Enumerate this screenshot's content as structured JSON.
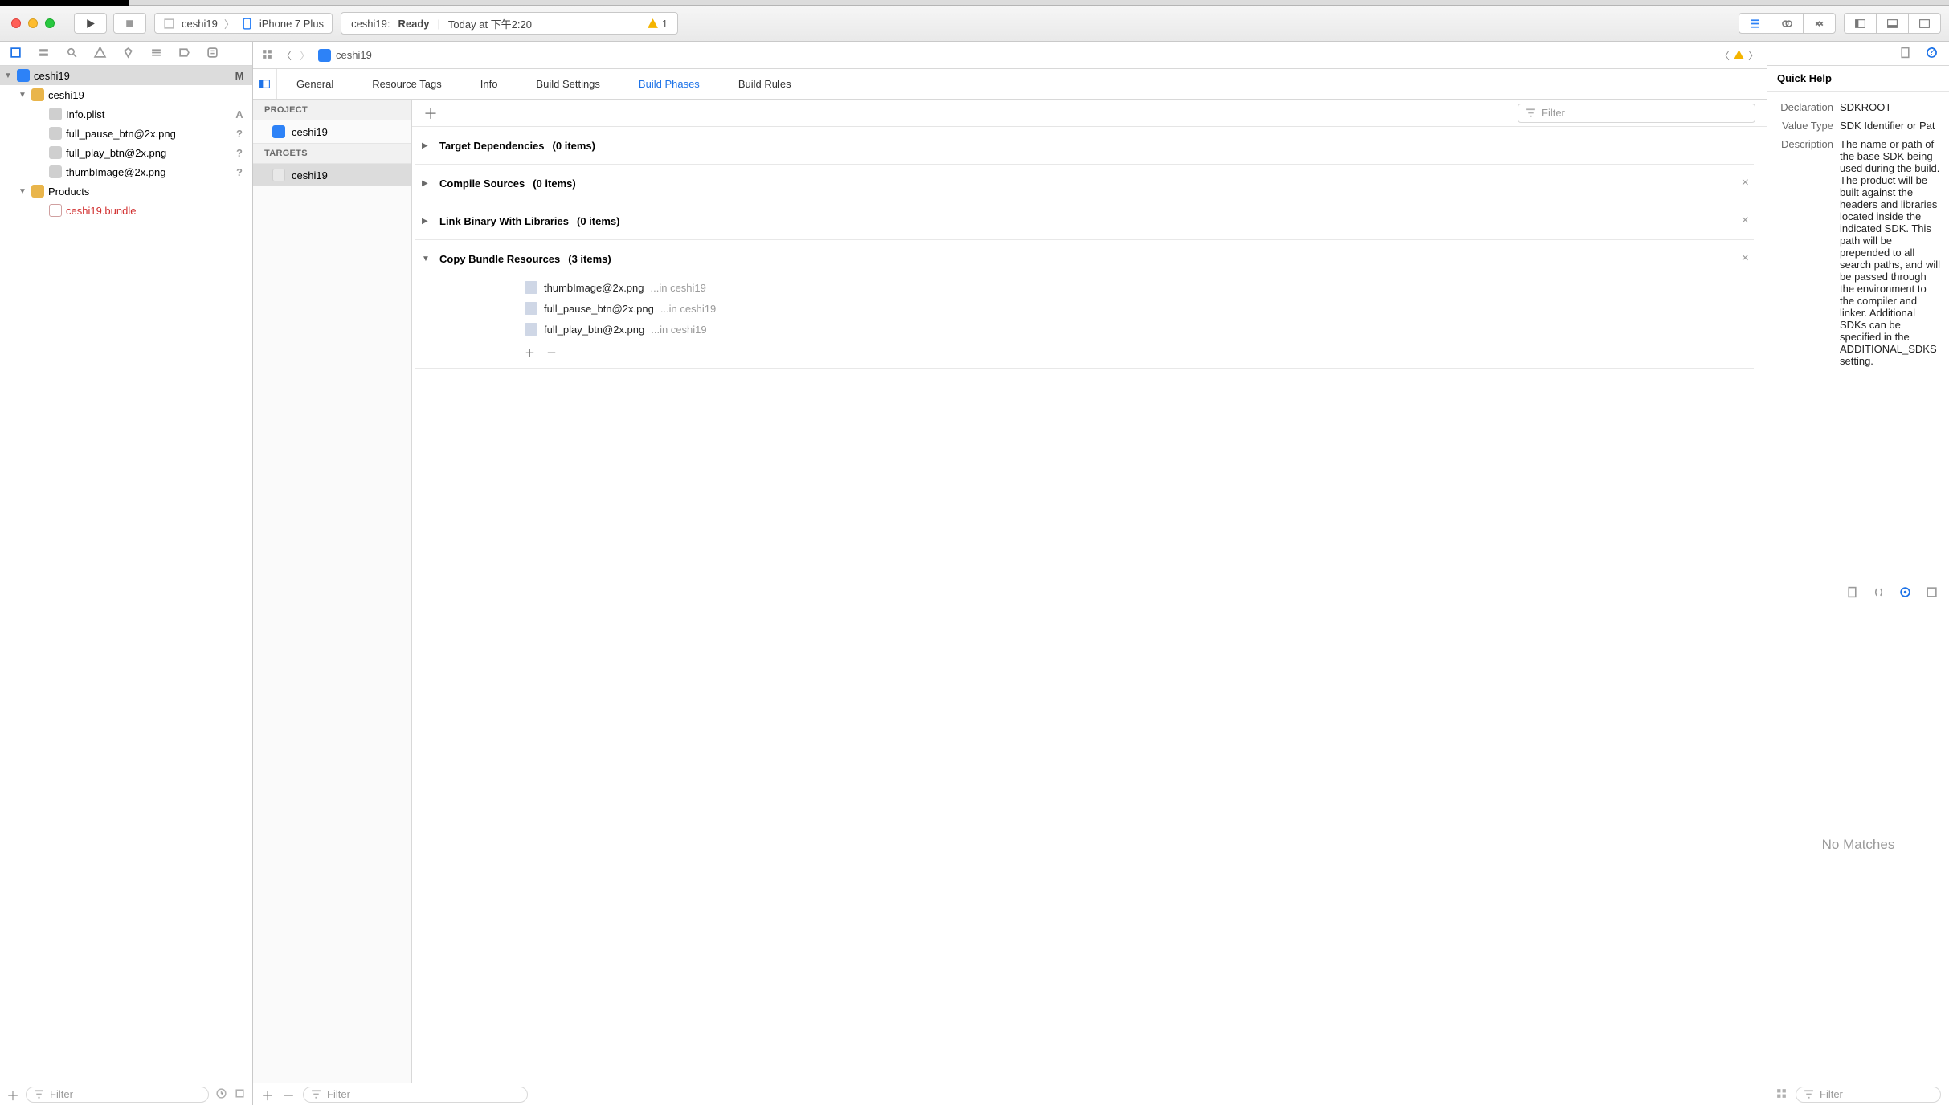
{
  "toolbar": {
    "scheme_project": "ceshi19",
    "scheme_device": "iPhone 7 Plus",
    "activity_project": "ceshi19:",
    "activity_status": "Ready",
    "activity_time": "Today at 下午2:20",
    "activity_warn_count": "1"
  },
  "navigator": {
    "root": {
      "name": "ceshi19",
      "status": "M"
    },
    "group": {
      "name": "ceshi19"
    },
    "files": [
      {
        "name": "Info.plist",
        "status": "A"
      },
      {
        "name": "full_pause_btn@2x.png",
        "status": "?"
      },
      {
        "name": "full_play_btn@2x.png",
        "status": "?"
      },
      {
        "name": "thumbImage@2x.png",
        "status": "?"
      }
    ],
    "products_group": "Products",
    "products_item": "ceshi19.bundle",
    "filter_placeholder": "Filter"
  },
  "jumpbar": {
    "crumb": "ceshi19"
  },
  "tabs": {
    "general": "General",
    "resource_tags": "Resource Tags",
    "info": "Info",
    "build_settings": "Build Settings",
    "build_phases": "Build Phases",
    "build_rules": "Build Rules"
  },
  "ptlist": {
    "project_hdr": "PROJECT",
    "project_item": "ceshi19",
    "targets_hdr": "TARGETS",
    "target_item": "ceshi19"
  },
  "phases": {
    "filter_placeholder": "Filter",
    "list": [
      {
        "title": "Target Dependencies",
        "count": "(0 items)",
        "expanded": false,
        "closable": false
      },
      {
        "title": "Compile Sources",
        "count": "(0 items)",
        "expanded": false,
        "closable": true
      },
      {
        "title": "Link Binary With Libraries",
        "count": "(0 items)",
        "expanded": false,
        "closable": true
      },
      {
        "title": "Copy Bundle Resources",
        "count": "(3 items)",
        "expanded": true,
        "closable": true
      }
    ],
    "copy_files": [
      {
        "name": "thumbImage@2x.png",
        "loc": "...in ceshi19"
      },
      {
        "name": "full_pause_btn@2x.png",
        "loc": "...in ceshi19"
      },
      {
        "name": "full_play_btn@2x.png",
        "loc": "...in ceshi19"
      }
    ]
  },
  "editor_filter_placeholder": "Filter",
  "inspector": {
    "title": "Quick Help",
    "declaration_k": "Declaration",
    "declaration_v": "SDKROOT",
    "valuetype_k": "Value Type",
    "valuetype_v": "SDK Identifier or Pat",
    "description_k": "Description",
    "description_v": "The name or path of the base SDK being used during the build. The product will be built against the headers and libraries located inside the indicated SDK. This path will be prepended to all search paths, and will be passed through the environment to the compiler and linker. Additional SDKs can be specified in the ADDITIONAL_SDKS setting.",
    "nomatch": "No Matches",
    "filter_placeholder": "Filter"
  }
}
